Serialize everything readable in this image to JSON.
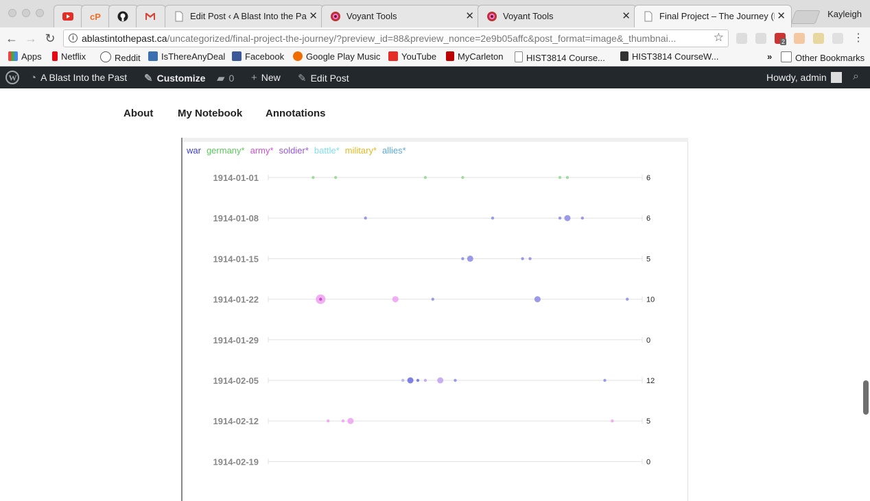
{
  "browser": {
    "tabs": [
      {
        "title": "Edit Post ‹ A Blast Into the Past",
        "favicon": "wordpress-icon"
      },
      {
        "title": "Voyant Tools",
        "favicon": "voyant-icon"
      },
      {
        "title": "Voyant Tools",
        "favicon": "voyant-icon"
      },
      {
        "title": "Final Project – The Journey (N",
        "favicon": "page-icon"
      }
    ],
    "profile": "Kayleigh",
    "url_host": "ablastintothepast.ca",
    "url_path": "/uncategorized/final-project-the-journey/?preview_id=88&preview_nonce=2e9b05affc&post_format=image&_thumbnai...",
    "bookmarks": [
      "Apps",
      "Netflix",
      "Reddit",
      "IsThereAnyDeal",
      "Facebook",
      "Google Play Music",
      "YouTube",
      "MyCarleton",
      "HIST3814 Course...",
      "HIST3814 CourseW...",
      "Other Bookmarks"
    ],
    "overflow": "»",
    "extension_badge": "2"
  },
  "adminbar": {
    "site": "A Blast Into the Past",
    "customize": "Customize",
    "comments": "0",
    "new": "New",
    "edit": "Edit Post",
    "howdy": "Howdy, admin"
  },
  "sitenav": {
    "items": [
      "About",
      "My Notebook",
      "Annotations"
    ]
  },
  "chart_data": {
    "type": "scatter",
    "legend": [
      {
        "label": "war",
        "color": "#3b3bd4"
      },
      {
        "label": "germany*",
        "color": "#5cc85c"
      },
      {
        "label": "army*",
        "color": "#d44fd4"
      },
      {
        "label": "soldier*",
        "color": "#9b55e0"
      },
      {
        "label": "battle*",
        "color": "#7fe0f0"
      },
      {
        "label": "military*",
        "color": "#e8b820"
      },
      {
        "label": "allies*",
        "color": "#5aa8e0"
      }
    ],
    "rows": [
      {
        "date": "1914-01-01",
        "total": "6"
      },
      {
        "date": "1914-01-08",
        "total": "6"
      },
      {
        "date": "1914-01-15",
        "total": "5"
      },
      {
        "date": "1914-01-22",
        "total": "10"
      },
      {
        "date": "1914-01-29",
        "total": "0"
      },
      {
        "date": "1914-02-05",
        "total": "12"
      },
      {
        "date": "1914-02-12",
        "total": "5"
      },
      {
        "date": "1914-02-19",
        "total": "0"
      }
    ],
    "points": [
      {
        "row": 0,
        "pos": 0.12,
        "size": 1,
        "color": "#8fd98f"
      },
      {
        "row": 0,
        "pos": 0.18,
        "size": 1,
        "color": "#8fd98f"
      },
      {
        "row": 0,
        "pos": 0.42,
        "size": 1,
        "color": "#8fd98f"
      },
      {
        "row": 0,
        "pos": 0.52,
        "size": 1,
        "color": "#8fd98f"
      },
      {
        "row": 0,
        "pos": 0.78,
        "size": 1,
        "color": "#8fd98f"
      },
      {
        "row": 0,
        "pos": 0.8,
        "size": 1,
        "color": "#8fd98f"
      },
      {
        "row": 1,
        "pos": 0.26,
        "size": 1,
        "color": "#8a8ae6"
      },
      {
        "row": 1,
        "pos": 0.6,
        "size": 1,
        "color": "#8a8ae6"
      },
      {
        "row": 1,
        "pos": 0.78,
        "size": 1,
        "color": "#8a8ae6"
      },
      {
        "row": 1,
        "pos": 0.8,
        "size": 3,
        "color": "#8a8ae6"
      },
      {
        "row": 1,
        "pos": 0.84,
        "size": 1,
        "color": "#8a8ae6"
      },
      {
        "row": 2,
        "pos": 0.52,
        "size": 1,
        "color": "#8a8ae6"
      },
      {
        "row": 2,
        "pos": 0.54,
        "size": 3,
        "color": "#8a8ae6"
      },
      {
        "row": 2,
        "pos": 0.68,
        "size": 1,
        "color": "#8a8ae6"
      },
      {
        "row": 2,
        "pos": 0.7,
        "size": 1,
        "color": "#8a8ae6"
      },
      {
        "row": 3,
        "pos": 0.14,
        "size": 5,
        "color": "#f0a0f0"
      },
      {
        "row": 3,
        "pos": 0.14,
        "size": 1,
        "color": "#c040c0"
      },
      {
        "row": 3,
        "pos": 0.34,
        "size": 3,
        "color": "#f0a0f0"
      },
      {
        "row": 3,
        "pos": 0.44,
        "size": 1,
        "color": "#8a8ae6"
      },
      {
        "row": 3,
        "pos": 0.72,
        "size": 3,
        "color": "#8a8ae6"
      },
      {
        "row": 3,
        "pos": 0.96,
        "size": 1,
        "color": "#8a8ae6"
      },
      {
        "row": 5,
        "pos": 0.36,
        "size": 1,
        "color": "#b0b0f0"
      },
      {
        "row": 5,
        "pos": 0.38,
        "size": 3,
        "color": "#6a6ae0"
      },
      {
        "row": 5,
        "pos": 0.4,
        "size": 1,
        "color": "#6a6ae0"
      },
      {
        "row": 5,
        "pos": 0.42,
        "size": 1,
        "color": "#c0a0f0"
      },
      {
        "row": 5,
        "pos": 0.46,
        "size": 3,
        "color": "#c0a0f0"
      },
      {
        "row": 5,
        "pos": 0.5,
        "size": 1,
        "color": "#8a8ae6"
      },
      {
        "row": 5,
        "pos": 0.9,
        "size": 1,
        "color": "#8a8ae6"
      },
      {
        "row": 6,
        "pos": 0.16,
        "size": 1,
        "color": "#f0a0f0"
      },
      {
        "row": 6,
        "pos": 0.2,
        "size": 1,
        "color": "#f0a0f0"
      },
      {
        "row": 6,
        "pos": 0.22,
        "size": 3,
        "color": "#f0a0f0"
      },
      {
        "row": 6,
        "pos": 0.92,
        "size": 1,
        "color": "#f0a0f0"
      }
    ]
  }
}
